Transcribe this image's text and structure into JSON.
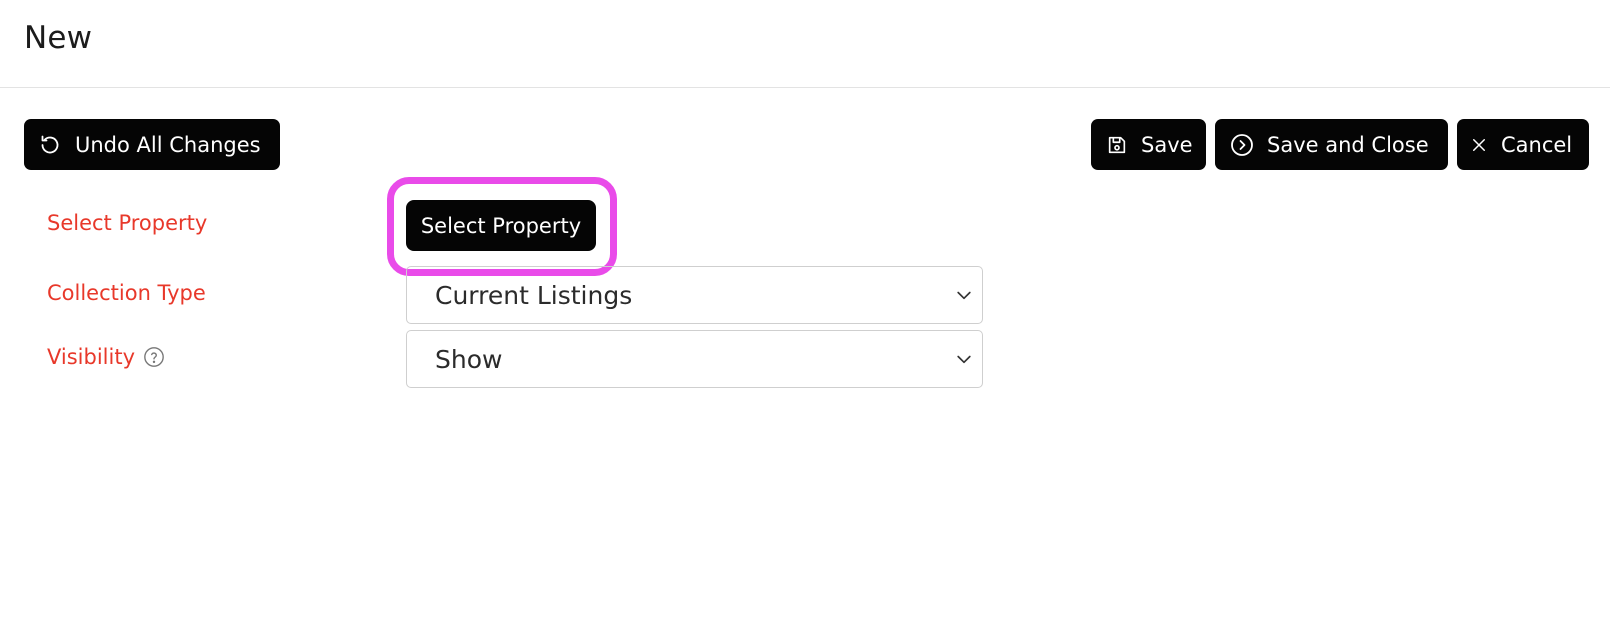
{
  "header": {
    "title": "New"
  },
  "toolbar": {
    "undo_label": "Undo All Changes",
    "save_label": "Save",
    "save_close_label": "Save and Close",
    "cancel_label": "Cancel"
  },
  "form": {
    "select_property": {
      "label": "Select Property",
      "button_label": "Select Property"
    },
    "collection_type": {
      "label": "Collection Type",
      "value": "Current Listings"
    },
    "visibility": {
      "label": "Visibility",
      "value": "Show"
    }
  },
  "icons": {
    "undo": "undo-icon",
    "save": "floppy-disk-icon",
    "save_close": "circle-chevron-right-icon",
    "cancel": "close-icon",
    "help": "question-circle-icon",
    "dropdown": "chevron-down-icon"
  },
  "colors": {
    "button_bg": "#050505",
    "label_text": "#e8382a",
    "highlight": "#e94be9"
  }
}
